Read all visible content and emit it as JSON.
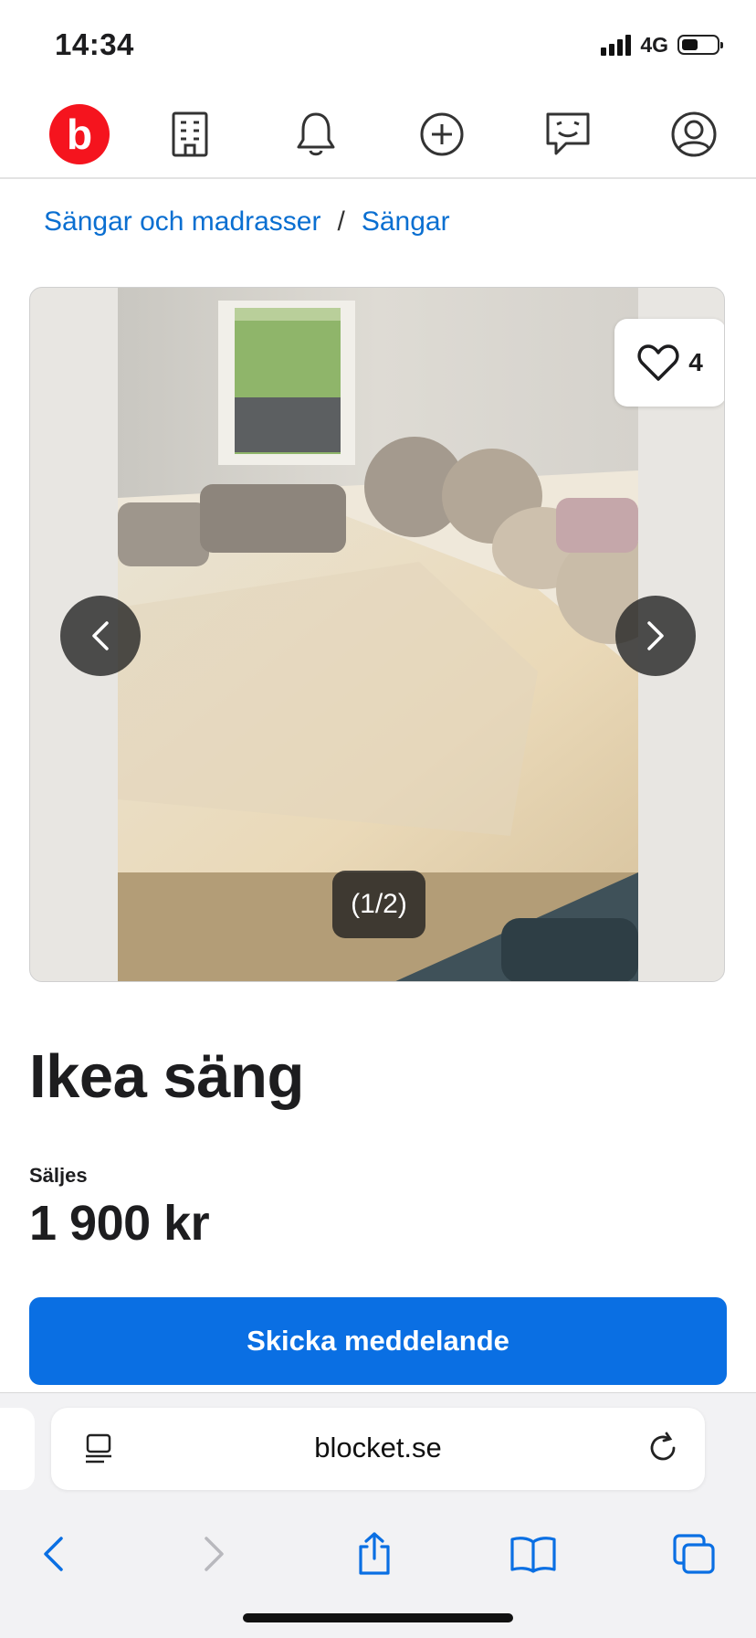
{
  "status": {
    "time": "14:34",
    "network": "4G"
  },
  "nav": {
    "logo_letter": "b"
  },
  "breadcrumb": {
    "items": [
      "Sängar och madrasser",
      "Sängar"
    ],
    "separator": "/"
  },
  "gallery": {
    "favorites_count": "4",
    "counter": "(1/2)"
  },
  "listing": {
    "title": "Ikea säng",
    "type": "Säljes",
    "price": "1 900 kr",
    "cta": "Skicka meddelande"
  },
  "browser": {
    "url": "blocket.se"
  },
  "colors": {
    "brand": "#f5141e",
    "accent": "#0a6fe3",
    "link": "#0a6fd1"
  }
}
